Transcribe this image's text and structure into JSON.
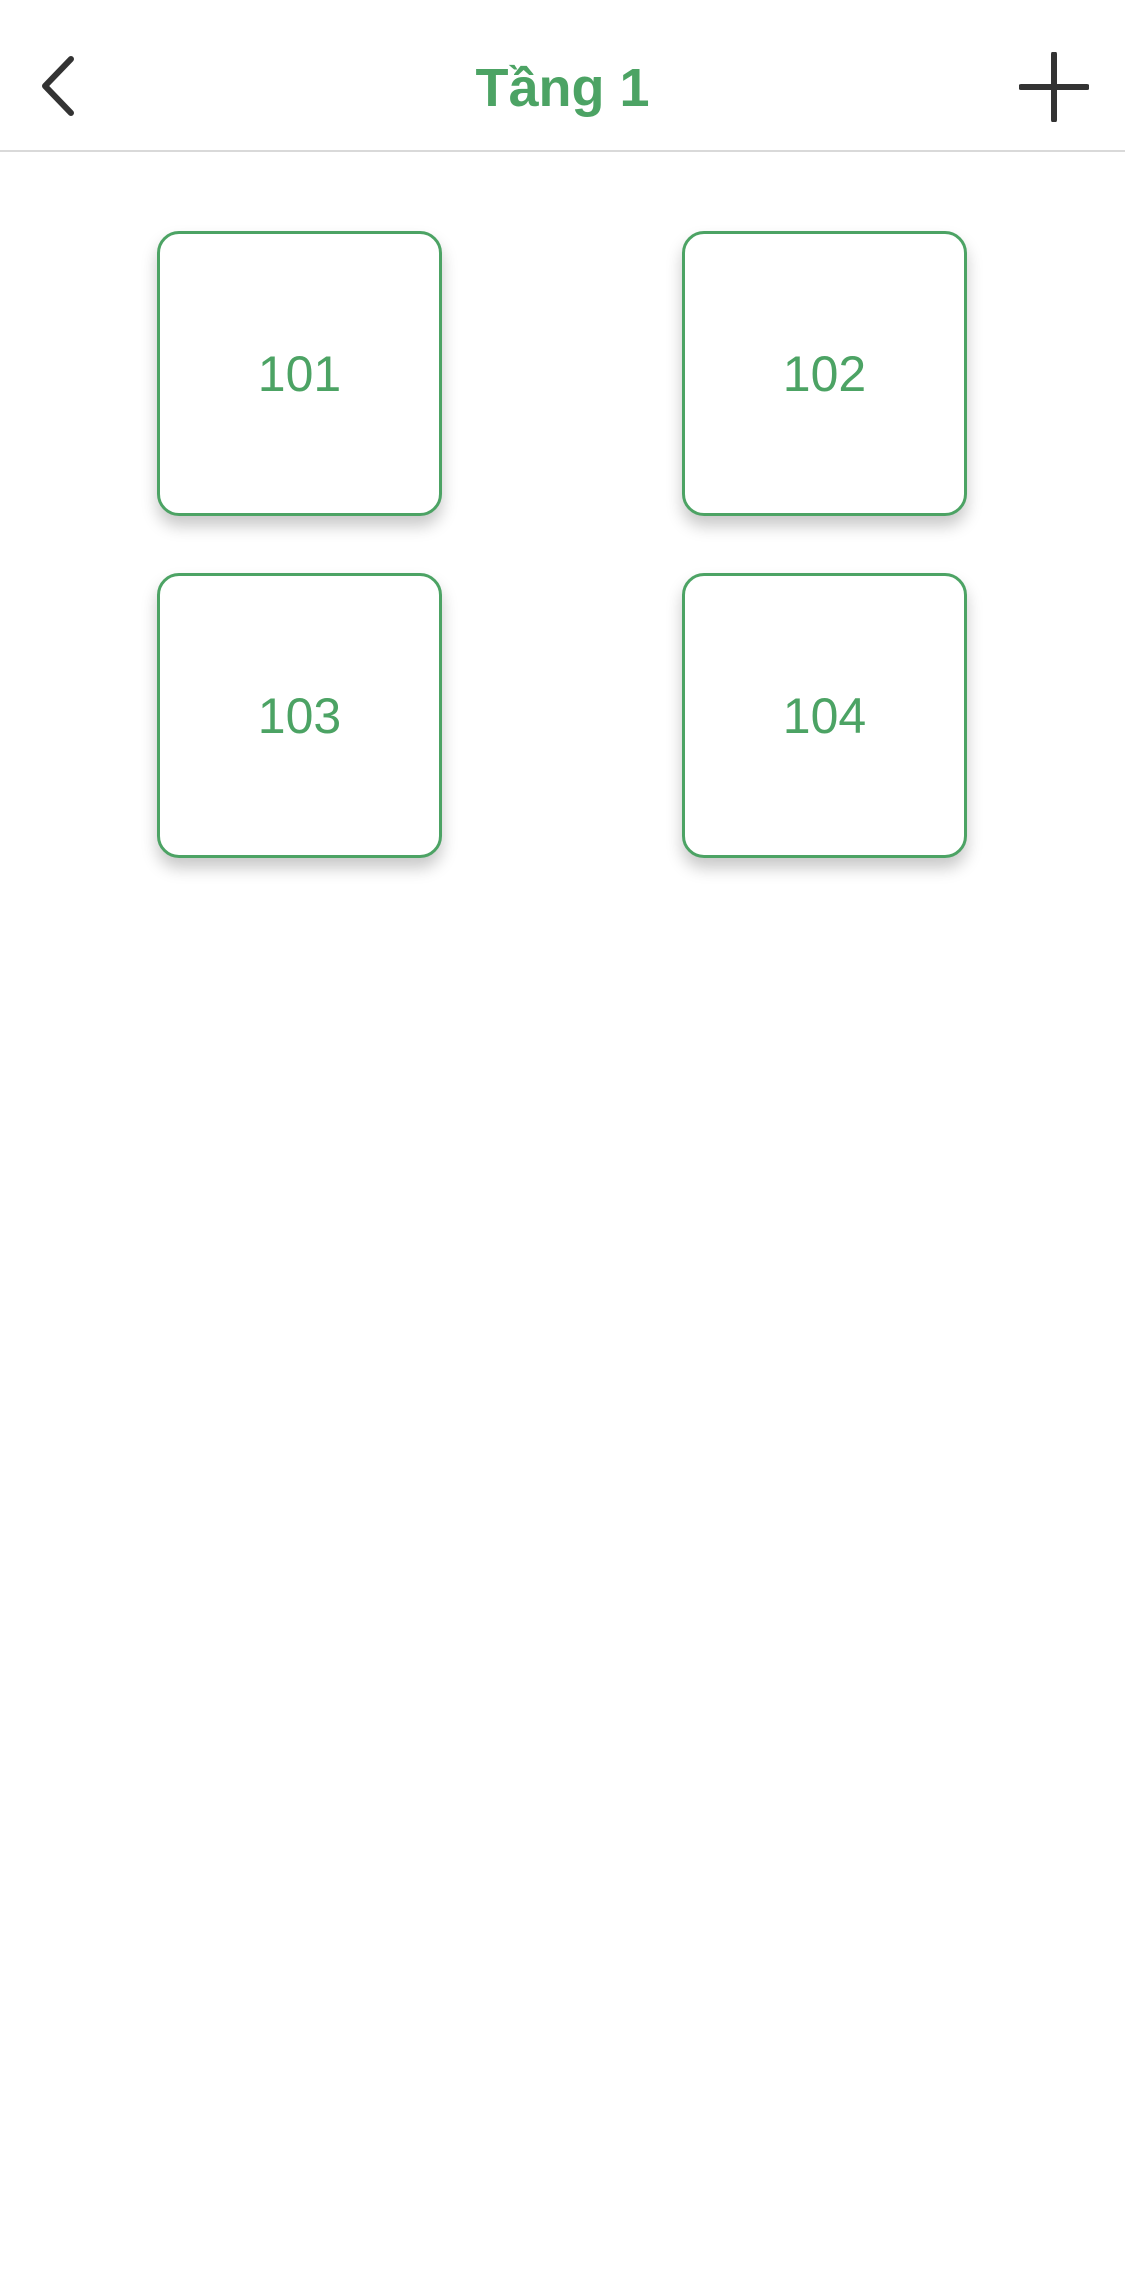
{
  "header": {
    "title": "Tầng 1",
    "back_icon": "chevron-left-icon",
    "add_icon": "plus-icon"
  },
  "rooms": [
    {
      "label": "101"
    },
    {
      "label": "102"
    },
    {
      "label": "103"
    },
    {
      "label": "104"
    }
  ],
  "colors": {
    "accent": "#4ca364",
    "icon": "#333333",
    "divider": "#d9d9d9",
    "background": "#ffffff"
  }
}
